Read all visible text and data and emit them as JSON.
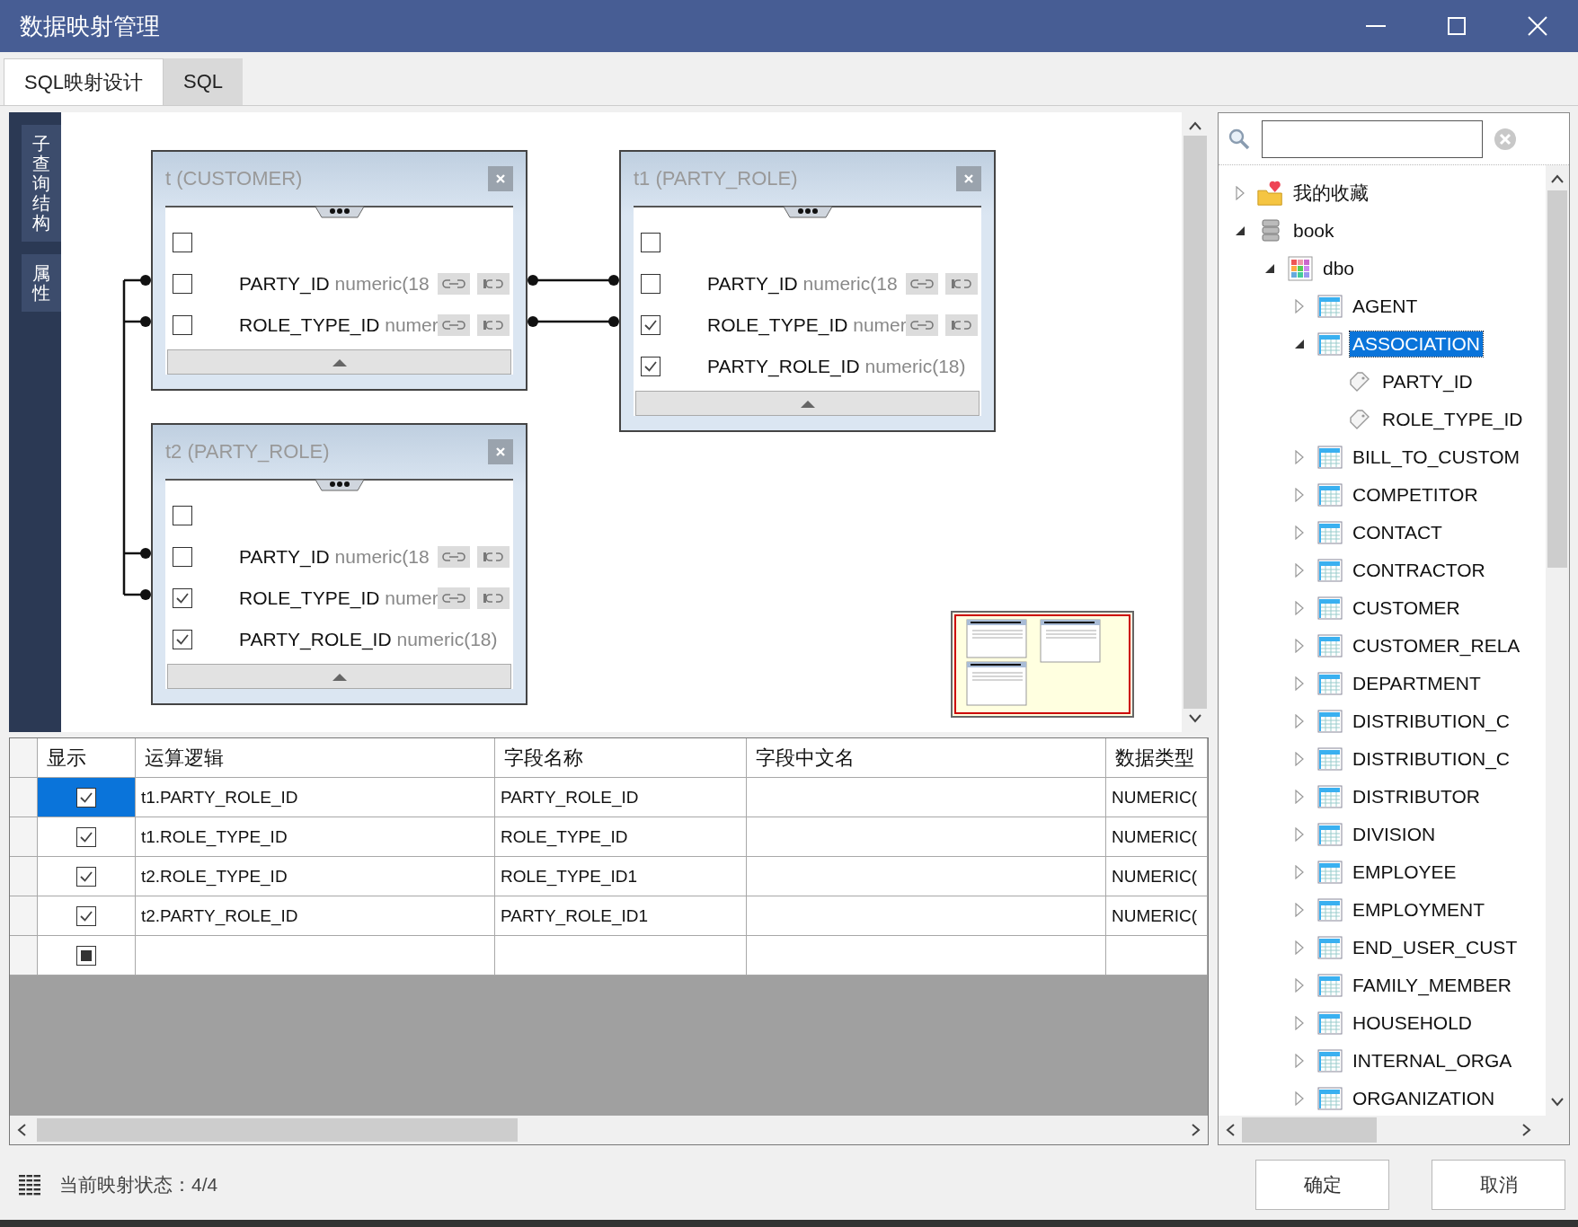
{
  "window": {
    "title": "数据映射管理"
  },
  "tabs": [
    {
      "label": "SQL映射设计",
      "selected": true
    },
    {
      "label": "SQL",
      "selected": false
    }
  ],
  "side_tabs": [
    {
      "label": "子查询结构"
    },
    {
      "label": "属性"
    }
  ],
  "tables": [
    {
      "title": "t (CUSTOMER)",
      "all_checked": false,
      "fields": [
        {
          "name": "PARTY_ID",
          "type": "numeric(18",
          "checked": false,
          "tools": true,
          "joined_left": true,
          "joined_right": true
        },
        {
          "name": "ROLE_TYPE_ID",
          "type": "numer",
          "checked": false,
          "tools": true,
          "joined_left": true,
          "joined_right": true
        }
      ]
    },
    {
      "title": "t1 (PARTY_ROLE)",
      "all_checked": false,
      "fields": [
        {
          "name": "PARTY_ID",
          "type": "numeric(18",
          "checked": false,
          "tools": true,
          "joined_left": true,
          "joined_right": false
        },
        {
          "name": "ROLE_TYPE_ID",
          "type": "numer",
          "checked": true,
          "tools": true,
          "joined_left": true,
          "joined_right": false
        },
        {
          "name": "PARTY_ROLE_ID",
          "type": "numeric(18)",
          "checked": true,
          "tools": false,
          "joined_left": false,
          "joined_right": false
        }
      ]
    },
    {
      "title": "t2 (PARTY_ROLE)",
      "all_checked": false,
      "fields": [
        {
          "name": "PARTY_ID",
          "type": "numeric(18",
          "checked": false,
          "tools": true,
          "joined_left": true,
          "joined_right": false
        },
        {
          "name": "ROLE_TYPE_ID",
          "type": "numer",
          "checked": true,
          "tools": true,
          "joined_left": true,
          "joined_right": false
        },
        {
          "name": "PARTY_ROLE_ID",
          "type": "numeric(18)",
          "checked": true,
          "tools": false,
          "joined_left": false,
          "joined_right": false
        }
      ]
    }
  ],
  "grid": {
    "columns": [
      "显示",
      "运算逻辑",
      "字段名称",
      "字段中文名",
      "数据类型"
    ],
    "rows": [
      {
        "kind": "data",
        "checked": true,
        "selected": true,
        "expression": "t1.PARTY_ROLE_ID",
        "field_name": "PARTY_ROLE_ID",
        "data_type": "NUMERIC("
      },
      {
        "kind": "data",
        "checked": true,
        "selected": false,
        "expression": "t1.ROLE_TYPE_ID",
        "field_name": "ROLE_TYPE_ID",
        "data_type": "NUMERIC("
      },
      {
        "kind": "data",
        "checked": true,
        "selected": false,
        "expression": "t2.ROLE_TYPE_ID",
        "field_name": "ROLE_TYPE_ID1",
        "data_type": "NUMERIC("
      },
      {
        "kind": "data",
        "checked": true,
        "selected": false,
        "expression": "t2.PARTY_ROLE_ID",
        "field_name": "PARTY_ROLE_ID1",
        "data_type": "NUMERIC("
      },
      {
        "kind": "new",
        "selected": false
      }
    ]
  },
  "tree": {
    "nodes": [
      {
        "label": "我的收藏",
        "kind": "favorites",
        "expanded": false,
        "selected": false
      },
      {
        "label": "book",
        "kind": "database",
        "expanded": true,
        "selected": false,
        "children": [
          {
            "label": "dbo",
            "kind": "schema",
            "expanded": true,
            "selected": false,
            "children": [
              {
                "label": "AGENT",
                "kind": "table",
                "expanded": false,
                "selected": false
              },
              {
                "label": "ASSOCIATION",
                "kind": "table",
                "expanded": true,
                "selected": true,
                "children": [
                  {
                    "label": "PARTY_ID",
                    "kind": "column",
                    "selected": false
                  },
                  {
                    "label": "ROLE_TYPE_ID",
                    "kind": "column",
                    "selected": false
                  }
                ]
              },
              {
                "label": "BILL_TO_CUSTOM",
                "kind": "table",
                "expanded": false,
                "selected": false
              },
              {
                "label": "COMPETITOR",
                "kind": "table",
                "expanded": false,
                "selected": false
              },
              {
                "label": "CONTACT",
                "kind": "table",
                "expanded": false,
                "selected": false
              },
              {
                "label": "CONTRACTOR",
                "kind": "table",
                "expanded": false,
                "selected": false
              },
              {
                "label": "CUSTOMER",
                "kind": "table",
                "expanded": false,
                "selected": false
              },
              {
                "label": "CUSTOMER_RELA",
                "kind": "table",
                "expanded": false,
                "selected": false
              },
              {
                "label": "DEPARTMENT",
                "kind": "table",
                "expanded": false,
                "selected": false
              },
              {
                "label": "DISTRIBUTION_C",
                "kind": "table",
                "expanded": false,
                "selected": false
              },
              {
                "label": "DISTRIBUTION_C",
                "kind": "table",
                "expanded": false,
                "selected": false
              },
              {
                "label": "DISTRIBUTOR",
                "kind": "table",
                "expanded": false,
                "selected": false
              },
              {
                "label": "DIVISION",
                "kind": "table",
                "expanded": false,
                "selected": false
              },
              {
                "label": "EMPLOYEE",
                "kind": "table",
                "expanded": false,
                "selected": false
              },
              {
                "label": "EMPLOYMENT",
                "kind": "table",
                "expanded": false,
                "selected": false
              },
              {
                "label": "END_USER_CUST",
                "kind": "table",
                "expanded": false,
                "selected": false
              },
              {
                "label": "FAMILY_MEMBER",
                "kind": "table",
                "expanded": false,
                "selected": false
              },
              {
                "label": "HOUSEHOLD",
                "kind": "table",
                "expanded": false,
                "selected": false
              },
              {
                "label": "INTERNAL_ORGA",
                "kind": "table",
                "expanded": false,
                "selected": false
              },
              {
                "label": "ORGANIZATION",
                "kind": "table",
                "expanded": false,
                "selected": false
              }
            ]
          }
        ]
      }
    ]
  },
  "status": {
    "text": "当前映射状态：4/4"
  },
  "buttons": [
    "确定",
    "取消"
  ]
}
